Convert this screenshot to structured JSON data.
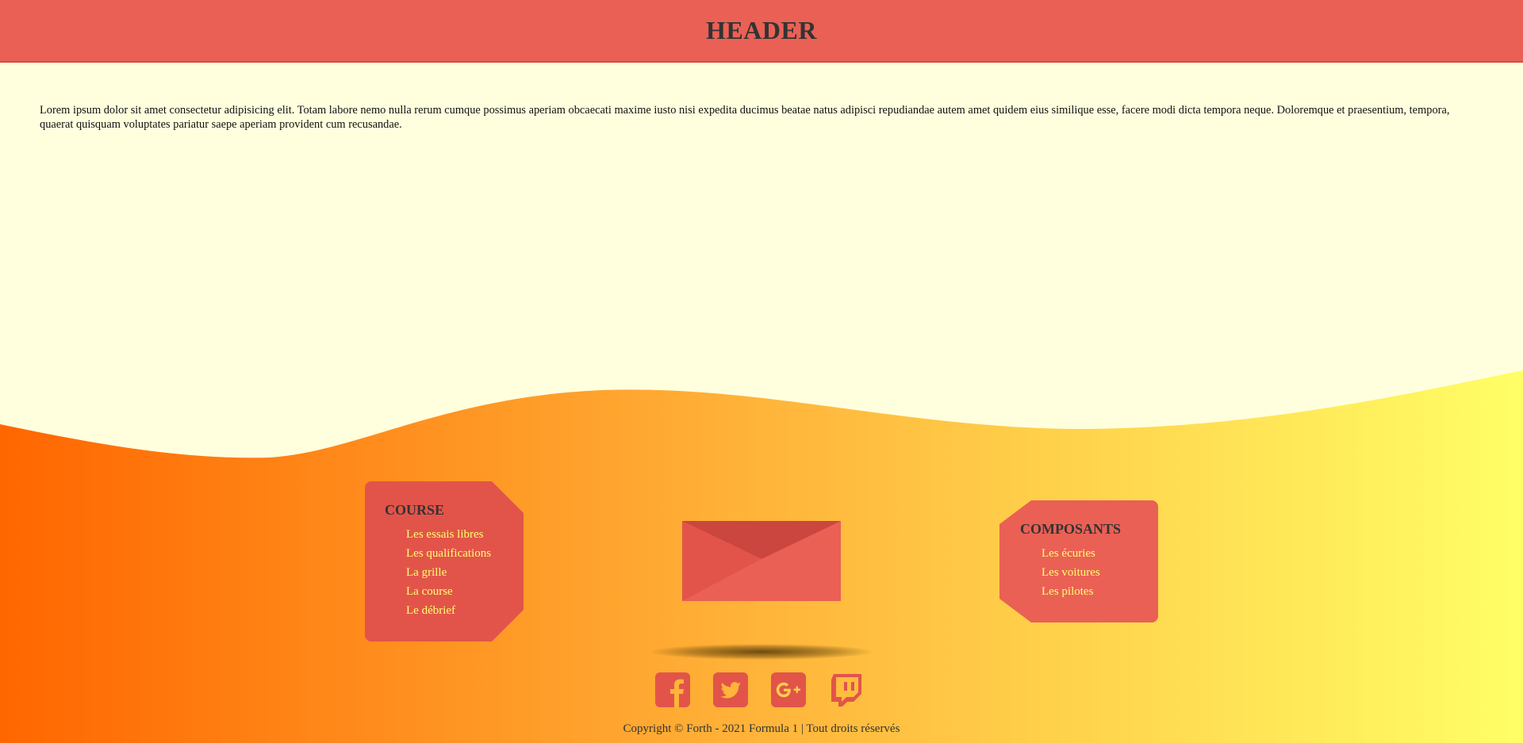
{
  "header": {
    "title": "HEADER"
  },
  "main": {
    "text": "Lorem ipsum dolor sit amet consectetur adipisicing elit. Totam labore nemo nulla rerum cumque possimus aperiam obcaecati maxime iusto nisi expedita ducimus beatae natus adipisci repudiandae autem amet quidem eius similique esse, facere modi dicta tempora neque. Doloremque et praesentium, tempora, quaerat quisquam voluptates pariatur saepe aperiam provident cum recusandae."
  },
  "footer": {
    "course": {
      "title": "COURSE",
      "links": [
        "Les essais libres",
        "Les qualifications",
        "La grille",
        "La course",
        "Le débrief"
      ]
    },
    "composants": {
      "title": "COMPOSANTS",
      "links": [
        "Les écuries",
        "Les voitures",
        "Les pilotes"
      ]
    },
    "socials": [
      "facebook-icon",
      "twitter-icon",
      "google-plus-icon",
      "twitch-icon"
    ],
    "copyright": "Copyright © Forth - 2021 Formula 1 | Tout droits réservés"
  },
  "colors": {
    "header_bg": "#ea6055",
    "page_bg": "#ffffde",
    "gradient_start": "#ff6600",
    "gradient_end": "#ffff66",
    "card_bg": "#e2544a",
    "link": "#ffff6e"
  }
}
